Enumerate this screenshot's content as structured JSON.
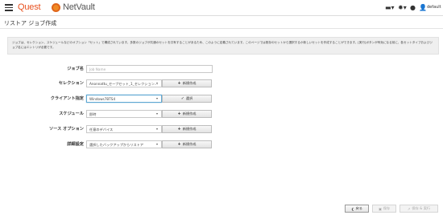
{
  "header": {
    "brand": "Quest",
    "product": "NetVault",
    "user": "default"
  },
  "page": {
    "title": "リストア ジョブ作成",
    "info": "ジョブは、セレクション、スケジュールなどのオプション「セット」で構成されています。多数のジョブが共通のセットを共有することがあるため、このように定義されています。このページでは既存のセットから選択するか新しいセットを作成することができます。[実行]ボタンが有効になる前に、各セットタイプおよびジョブ名にはエントリが必要です。"
  },
  "form": {
    "job_name": {
      "label": "ジョブ名",
      "placeholder": "Job Name"
    },
    "selection": {
      "label": "セレクション",
      "value": "Anonnattu_セーブセット_1_セレクション...",
      "button": "新規作成"
    },
    "client": {
      "label": "クライアント指定",
      "value": "Windows7BTS4",
      "button": "選択"
    },
    "schedule": {
      "label": "スケジュール",
      "value": "即時",
      "button": "新規作成"
    },
    "source": {
      "label": "ソース オプション",
      "value": "任意のデバイス",
      "button": "新規作成"
    },
    "advanced": {
      "label": "詳細設定",
      "value": "選択したバックアップからリストア",
      "button": "新規作成"
    }
  },
  "footer": {
    "back": "戻る",
    "save": "保存",
    "save_run": "保存 & 実行"
  },
  "icons": {
    "menu": "hamburger-icon",
    "chat": "chat-icon",
    "settings": "gear-icon",
    "help": "info-icon",
    "user": "user-icon",
    "plus": "plus-icon",
    "check": "check-icon",
    "back": "chevron-left-icon",
    "save": "save-icon",
    "run": "run-icon"
  },
  "colors": {
    "brand_orange": "#e8511f",
    "focus_blue": "#5fa8d3"
  }
}
